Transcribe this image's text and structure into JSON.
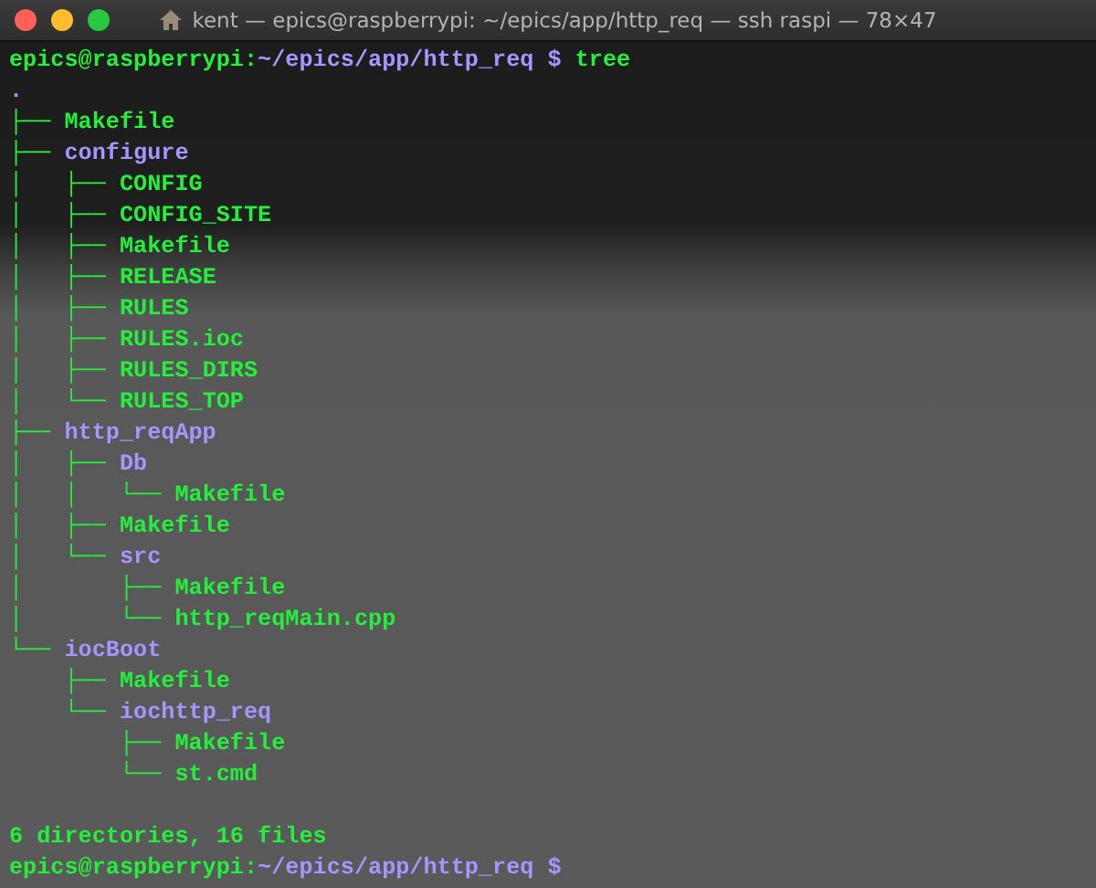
{
  "window": {
    "title": "kent — epics@raspberrypi: ~/epics/app/http_req — ssh raspi — 78×47"
  },
  "prompt": {
    "user_host": "epics@raspberrypi:",
    "path": "~/epics/app/http_req",
    "symbol": "$",
    "command": "tree"
  },
  "tree": {
    "root": ".",
    "children": [
      {
        "branch": "├── ",
        "name": "Makefile",
        "kind": "file"
      },
      {
        "branch": "├── ",
        "name": "configure",
        "kind": "dir",
        "children": [
          {
            "branch": "│   ├── ",
            "name": "CONFIG",
            "kind": "file"
          },
          {
            "branch": "│   ├── ",
            "name": "CONFIG_SITE",
            "kind": "file"
          },
          {
            "branch": "│   ├── ",
            "name": "Makefile",
            "kind": "file"
          },
          {
            "branch": "│   ├── ",
            "name": "RELEASE",
            "kind": "file"
          },
          {
            "branch": "│   ├── ",
            "name": "RULES",
            "kind": "file"
          },
          {
            "branch": "│   ├── ",
            "name": "RULES.ioc",
            "kind": "file"
          },
          {
            "branch": "│   ├── ",
            "name": "RULES_DIRS",
            "kind": "file"
          },
          {
            "branch": "│   └── ",
            "name": "RULES_TOP",
            "kind": "file"
          }
        ]
      },
      {
        "branch": "├── ",
        "name": "http_reqApp",
        "kind": "dir",
        "children": [
          {
            "branch": "│   ├── ",
            "name": "Db",
            "kind": "dir",
            "children": [
              {
                "branch": "│   │   └── ",
                "name": "Makefile",
                "kind": "file"
              }
            ]
          },
          {
            "branch": "│   ├── ",
            "name": "Makefile",
            "kind": "file"
          },
          {
            "branch": "│   └── ",
            "name": "src",
            "kind": "dir",
            "children": [
              {
                "branch": "│       ├── ",
                "name": "Makefile",
                "kind": "file"
              },
              {
                "branch": "│       └── ",
                "name": "http_reqMain.cpp",
                "kind": "file"
              }
            ]
          }
        ]
      },
      {
        "branch": "└── ",
        "name": "iocBoot",
        "kind": "dir",
        "children": [
          {
            "branch": "    ├── ",
            "name": "Makefile",
            "kind": "file"
          },
          {
            "branch": "    └── ",
            "name": "iochttp_req",
            "kind": "dir",
            "children": [
              {
                "branch": "        ├── ",
                "name": "Makefile",
                "kind": "file"
              },
              {
                "branch": "        └── ",
                "name": "st.cmd",
                "kind": "file"
              }
            ]
          }
        ]
      }
    ]
  },
  "summary": "6 directories, 16 files",
  "final_prompt": {
    "user_host": "epics@raspberrypi:",
    "path": "~/epics/app/http_req",
    "symbol": "$"
  }
}
